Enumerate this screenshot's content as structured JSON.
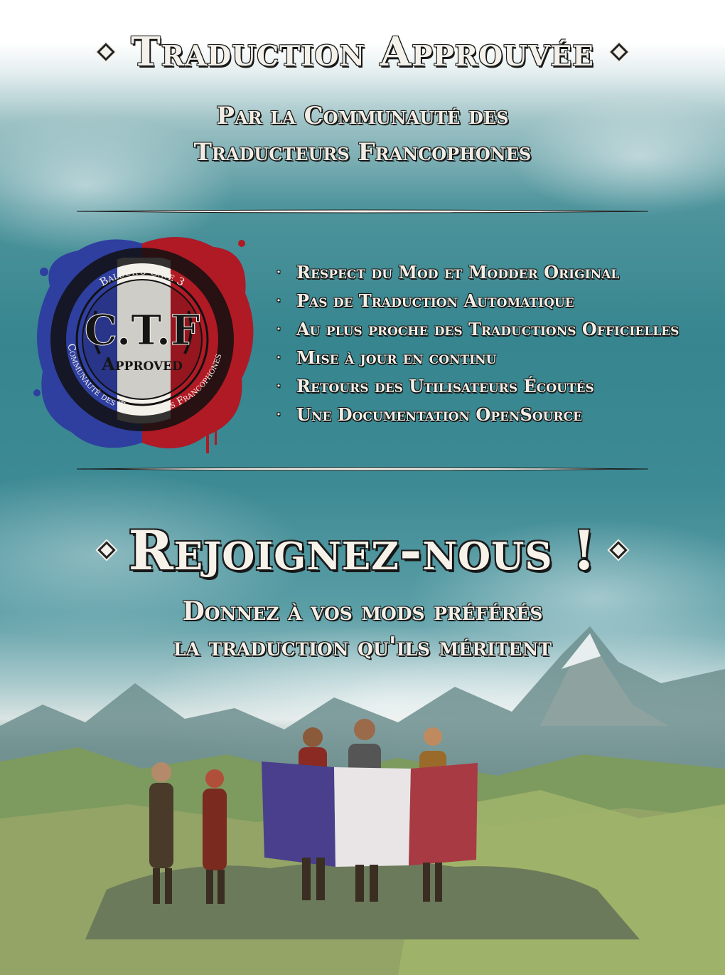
{
  "header": {
    "title": "Traduction Approuvée",
    "subtitle_line1": "Par la Communauté des",
    "subtitle_line2": "Traducteurs Francophones"
  },
  "badge": {
    "top_text": "Baldur's Gate 3",
    "initials": "C.T.F",
    "stamp": "Approved",
    "ring_text": "Communauté des Traducteurs Francophones"
  },
  "features": [
    "Respect du Mod et Modder Original",
    "Pas de Traduction Automatique",
    "Au plus proche des Traductions Officielles",
    "Mise à jour en continu",
    "Retours des Utilisateurs Écoutés",
    "Une Documentation OpenSource"
  ],
  "join": {
    "title": "Rejoignez-nous !",
    "line1": "Donnez à vos mods préférés",
    "line2": "la traduction qu'ils méritent"
  },
  "colors": {
    "flag_blue": "#2f3fa0",
    "flag_white": "#f4f1ea",
    "flag_red": "#b01a24",
    "sky_teal": "#36858f",
    "text_light": "#f4f1ea"
  }
}
